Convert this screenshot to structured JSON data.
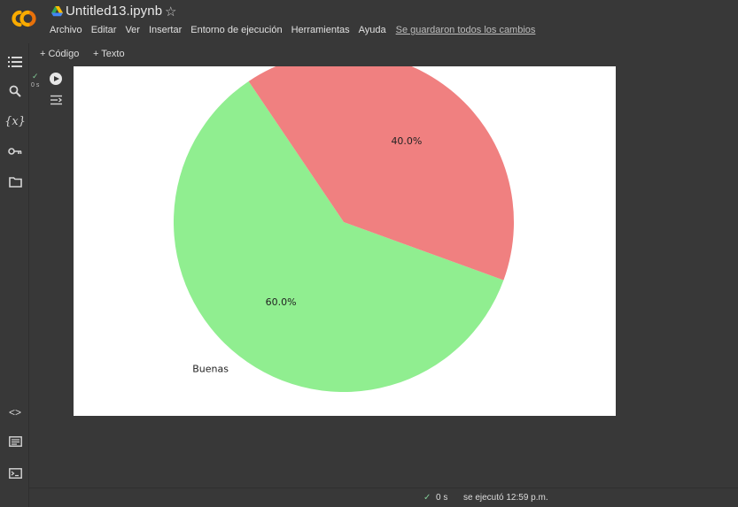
{
  "app": {
    "notebook_title": "Untitled13.ipynb",
    "brand_color": "#F9AB00"
  },
  "menu": {
    "items": [
      "Archivo",
      "Editar",
      "Ver",
      "Insertar",
      "Entorno de ejecución",
      "Herramientas",
      "Ayuda"
    ],
    "save_status": "Se guardaron todos los cambios"
  },
  "toolbar": {
    "add_code": "+ Código",
    "add_text": "+ Texto"
  },
  "sidebar": {
    "top_icons": [
      "table-of-contents-icon",
      "search-icon",
      "variables-icon",
      "secrets-key-icon",
      "folder-icon"
    ],
    "variables_glyph": "{x}",
    "code_glyph": "<>",
    "bottom_icons": [
      "code-snippets-icon",
      "command-palette-icon",
      "terminal-icon"
    ]
  },
  "cell": {
    "status_check": "✓",
    "exec_time": "0 s"
  },
  "chart_data": {
    "type": "pie",
    "slices": [
      {
        "label": "Buenas",
        "value": 60.0,
        "pct_label": "60.0%",
        "color": "#90EE90"
      },
      {
        "label": "",
        "value": 40.0,
        "pct_label": "40.0%",
        "color": "#F08080"
      }
    ],
    "title": ""
  },
  "footer": {
    "check": "✓",
    "time": "0 s",
    "text": "se ejecutó 12:59 p.m."
  }
}
